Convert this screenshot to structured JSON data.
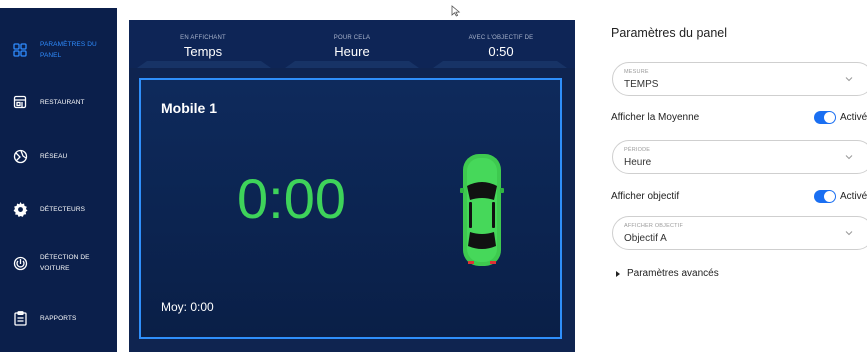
{
  "sidebar": {
    "items": [
      {
        "label": "PARAMÈTRES DU PANEL",
        "icon": "grid-icon",
        "active": true
      },
      {
        "label": "RESTAURANT",
        "icon": "store-icon"
      },
      {
        "label": "RÉSEAU",
        "icon": "network-icon"
      },
      {
        "label": "DÉTECTEURS",
        "icon": "gear-icon"
      },
      {
        "label": "DÉTECTION DE VOITURE",
        "icon": "detection-icon"
      },
      {
        "label": "RAPPORTS",
        "icon": "clipboard-icon"
      }
    ],
    "accent": "#2f8cff",
    "bg": "#0b1f4b"
  },
  "header": {
    "cols": [
      {
        "caption": "EN AFFICHANT",
        "value": "Temps"
      },
      {
        "caption": "POUR CELA",
        "value": "Heure"
      },
      {
        "caption": "AVEC L'OBJECTIF DE",
        "value": "0:50"
      }
    ]
  },
  "panel": {
    "title": "Mobile 1",
    "time": "0:00",
    "average": "Moy: 0:00",
    "time_color": "#3ed35a",
    "border_color": "#2f8ffb"
  },
  "settings": {
    "title": "Paramètres du panel",
    "measure": {
      "caption": "MESURE",
      "value": "TEMPS"
    },
    "show_average": {
      "label": "Afficher la Moyenne",
      "state": "Activé",
      "on": true
    },
    "period": {
      "caption": "PÉRIODE",
      "value": "Heure"
    },
    "show_objective": {
      "label": "Afficher objectif",
      "state": "Activé",
      "on": true
    },
    "objective": {
      "caption": "AFFICHER OBJECTIF",
      "value": "Objectif A"
    },
    "advanced": "Paramètres avancés",
    "toggle_color": "#1a6ff2"
  }
}
